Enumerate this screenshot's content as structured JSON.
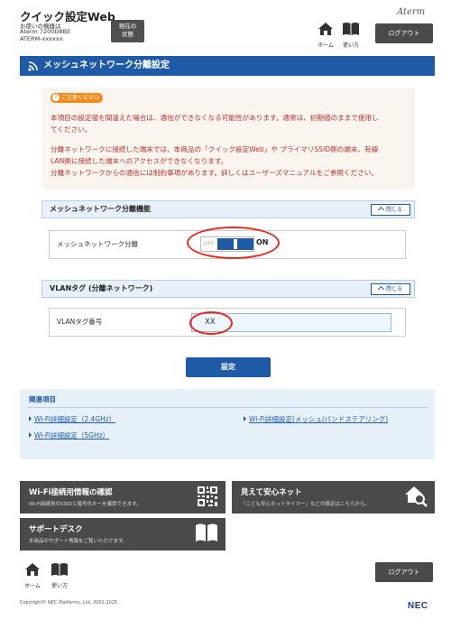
{
  "header": {
    "app_title": "クイック設定Web",
    "device_lines": [
      "お使いの機器は",
      "Aterm 7200D8BE",
      "ATERM-xxxxxx"
    ],
    "status_button": [
      "現在の",
      "状態"
    ],
    "brand": "Aterm",
    "home_label": "ホーム",
    "manual_label": "使い方",
    "logout_label": "ログアウト"
  },
  "page": {
    "title": "メッシュネットワーク分離設定"
  },
  "caution": {
    "badge": "ご注意ください",
    "lines": [
      "本項目の設定値を間違えた場合は、通信ができなくなる可能性があります。通常は、初期値のままで使用し",
      "てください。",
      "分離ネットワークに接続した端末では、本商品の「クイック設定Web」や プライマリSSID側の端末、有線",
      "LAN側に接続した端末へのアクセスができなくなります。",
      "分離ネットワークからの通信には制約事項があります。詳しくはユーザーズマニュアルをご参照ください。"
    ]
  },
  "separation_panel": {
    "title": "メッシュネットワーク分離機能",
    "close_label": "閉じる",
    "row_label": "メッシュネットワーク分離",
    "toggle_off": "OFF",
    "toggle_on": "ON",
    "toggle_state": "on"
  },
  "vlan_panel": {
    "title": "VLANタグ (分離ネットワーク)",
    "close_label": "閉じる",
    "row_label": "VLANタグ番号",
    "value": "XX"
  },
  "set_button": "設定",
  "related": {
    "title": "関連項目",
    "links": [
      "Wi-Fi詳細設定（2.4GHz）",
      "Wi-Fi詳細設定（5GHz）",
      "Wi-Fi詳細設定(メッシュ/バンドステアリング)"
    ]
  },
  "cards": [
    {
      "title": "Wi-Fi接続用情報の確認",
      "desc": "Wi-Fi接続用のSSIDと暗号化キーを確認できます。",
      "icon": "qr-code-icon"
    },
    {
      "title": "見えて安心ネット",
      "desc": "「こども安心ネットタイマー」などの設定はこちらから。",
      "icon": "home-search-icon"
    },
    {
      "title": "サポートデスク",
      "desc": "本商品のサポート情報をご覧いただけます。",
      "icon": "book-icon"
    }
  ],
  "footer": {
    "logout_label": "ログアウト",
    "copyright": "Copyright© NEC Platforms, Ltd. 2001-2025",
    "logo": "NEC"
  },
  "colors": {
    "accent": "#1f5aa6",
    "caution_text": "#b2322b",
    "highlight_ring": "#e8291c",
    "dark_button": "#4a4a4a"
  }
}
